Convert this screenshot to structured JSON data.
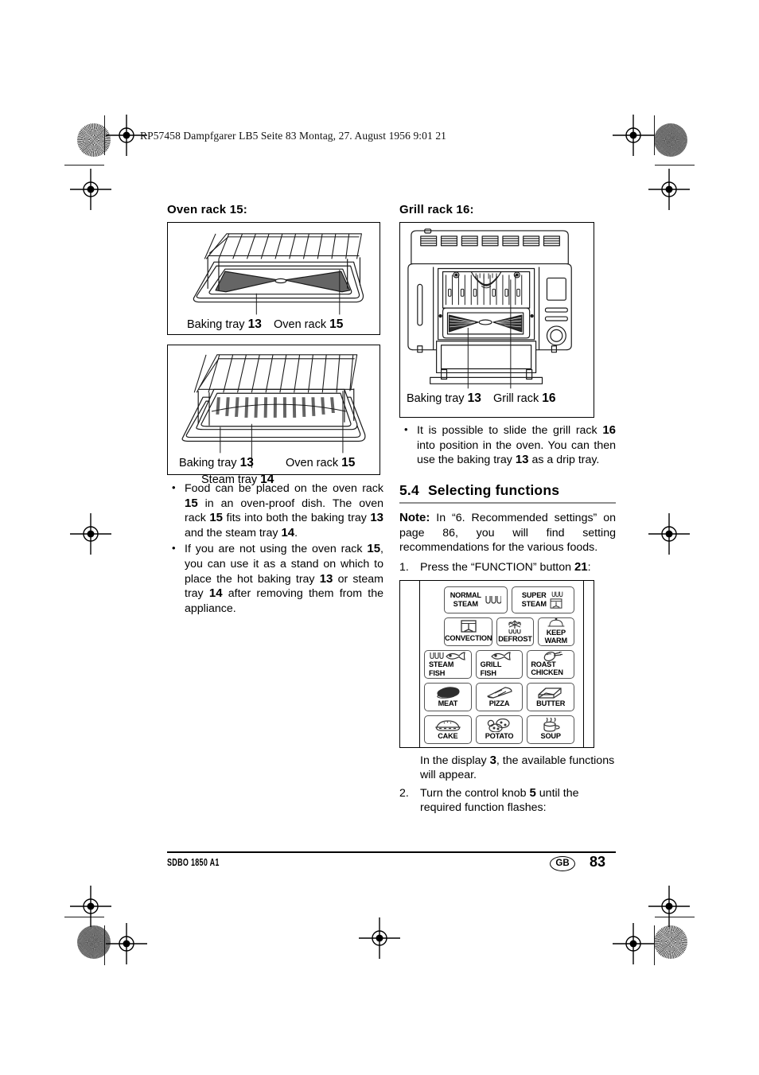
{
  "header": {
    "slug": "RP57458 Dampfgarer LB5  Seite 83  Montag, 27. August 1956  9:01 21"
  },
  "left_column": {
    "figure1": {
      "title": "Oven rack 15:",
      "caption_left": "Baking tray",
      "caption_left_num": "13",
      "caption_right": "Oven rack",
      "caption_right_num": "15"
    },
    "figure2": {
      "caption_a": "Baking tray",
      "caption_a_num": "13",
      "caption_b": "Oven rack",
      "caption_b_num": "15",
      "caption_c": "Steam tray",
      "caption_c_num": "14"
    },
    "bullets": [
      "Food can be placed on the oven rack 15 in an oven-proof dish. The oven rack 15 fits into both the baking tray 13 and the steam tray 14.",
      "If you are not using the oven rack 15, you can use it as a stand on which to place the hot baking tray 13 or steam tray 14 after removing them from the appliance."
    ]
  },
  "right_column": {
    "figure3": {
      "title": "Grill rack 16:",
      "caption_left": "Baking tray",
      "caption_left_num": "13",
      "caption_right": "Grill rack",
      "caption_right_num": "16"
    },
    "bullet": "It is possible to slide the grill rack 16 into position in the oven. You can then use the baking tray 13 as a drip tray.",
    "section": {
      "number": "5.4",
      "title": "Selecting functions"
    },
    "note_label": "Note:",
    "note_text": "In “6. Recommended settings” on page 86, you will find setting recommendations for the various foods.",
    "step1_num": "1.",
    "step1_text_a": "Press the “FUNCTION” button",
    "step1_num_bold": "21",
    "step1_text_b": ":",
    "after_panel_a": "In the display",
    "after_panel_bold": "3",
    "after_panel_b": ", the available functions will appear.",
    "step2_num": "2.",
    "step2_text_a": "Turn the control knob",
    "step2_bold": "5",
    "step2_text_b": "until the required function flashes:"
  },
  "keypad": {
    "rows": [
      [
        {
          "label": "NORMAL\nSTEAM",
          "icon": "steam-drops-icon",
          "width": "wide"
        },
        {
          "label": "SUPER\nSTEAM",
          "icon": "super-steam-icon",
          "width": "wide"
        }
      ],
      [
        {
          "label": "CONVECTION",
          "icon": "convection-icon",
          "width": "std"
        },
        {
          "label": "DEFROST",
          "icon": "defrost-snowflake-icon",
          "width": "std"
        },
        {
          "label": "KEEP WARM",
          "icon": "cloche-icon",
          "width": "std"
        }
      ],
      [
        {
          "label": "STEAM\nFISH",
          "icon": "steam-fish-icon",
          "width": "std"
        },
        {
          "label": "GRILL\nFISH",
          "icon": "fish-icon",
          "width": "std"
        },
        {
          "label": "ROAST\nCHICKEN",
          "icon": "chicken-leg-icon",
          "width": "std"
        }
      ],
      [
        {
          "label": "MEAT",
          "icon": "meat-icon",
          "width": "std"
        },
        {
          "label": "PIZZA",
          "icon": "pizza-slice-icon",
          "width": "std"
        },
        {
          "label": "BUTTER",
          "icon": "butter-block-icon",
          "width": "std"
        }
      ],
      [
        {
          "label": "CAKE",
          "icon": "cake-icon",
          "width": "std"
        },
        {
          "label": "POTATO",
          "icon": "potato-icon",
          "width": "std"
        },
        {
          "label": "SOUP",
          "icon": "soup-pot-icon",
          "width": "std"
        }
      ]
    ]
  },
  "footer": {
    "model": "SDBO 1850 A1",
    "locale": "GB",
    "page": "83"
  },
  "colors": {
    "ink": "#000000",
    "rule_grey": "#8e8e8e",
    "line_art": "#1a1a1a"
  }
}
